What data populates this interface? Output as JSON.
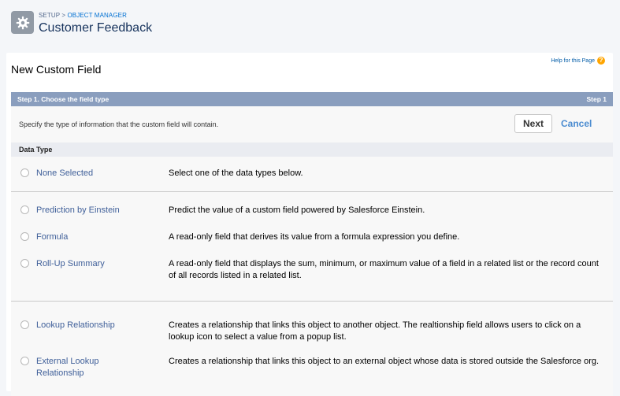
{
  "header": {
    "breadcrumb_setup": "SETUP",
    "breadcrumb_sep": ">",
    "breadcrumb_object_manager": "OBJECT MANAGER",
    "title": "Customer Feedback",
    "icon": "gear-icon"
  },
  "page": {
    "title": "New Custom Field",
    "help_link": "Help for this Page",
    "help_icon": "question-icon"
  },
  "step": {
    "title": "Step 1. Choose the field type",
    "counter": "Step 1",
    "instruction": "Specify the type of information that the custom field will contain.",
    "next_label": "Next",
    "cancel_label": "Cancel"
  },
  "data_type": {
    "header": "Data Type",
    "options": [
      {
        "label": "None Selected",
        "description": "Select one of the data types below."
      },
      {
        "label": "Prediction by Einstein",
        "description": "Predict the value of a custom field powered by Salesforce Einstein."
      },
      {
        "label": "Formula",
        "description": "A read-only field that derives its value from a formula expression you define."
      },
      {
        "label": "Roll-Up Summary",
        "description": "A read-only field that displays the sum, minimum, or maximum value of a field in a related list or the record count of all records listed in a related list."
      },
      {
        "label": "Lookup Relationship",
        "description": "Creates a relationship that links this object to another object. The realtionship field allows users to click on a lookup icon to select a value from a popup list."
      },
      {
        "label": "External Lookup Relationship",
        "description": "Creates a relationship that links this object to an external object whose data is stored outside the Salesforce org."
      }
    ]
  },
  "colors": {
    "step_bar": "#8a9ebe",
    "link": "#3f5f99",
    "cancel": "#4a8bd0",
    "help_icon": "#ffa500"
  }
}
